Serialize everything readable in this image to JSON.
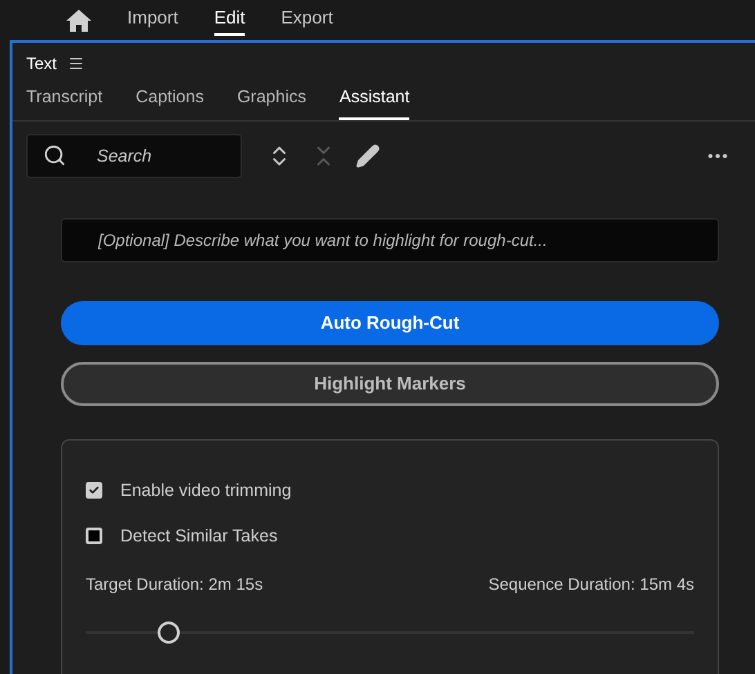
{
  "nav": [
    {
      "kind": "home",
      "selected": false
    },
    {
      "kind": "text",
      "label": "Import",
      "selected": false
    },
    {
      "kind": "text",
      "label": "Edit",
      "selected": true
    },
    {
      "kind": "text",
      "label": "Export",
      "selected": false
    }
  ],
  "panel": {
    "title": "Text"
  },
  "tabs": [
    {
      "label": "Transcript",
      "selected": false
    },
    {
      "label": "Captions",
      "selected": false
    },
    {
      "label": "Graphics",
      "selected": false
    },
    {
      "label": "Assistant",
      "selected": true
    }
  ],
  "search": {
    "placeholder": "Search"
  },
  "toolbar": [
    {
      "kind": "expand",
      "disabled": false
    },
    {
      "kind": "collapse",
      "disabled": true
    },
    {
      "kind": "edit",
      "disabled": false
    }
  ],
  "prompt": {
    "placeholder": "[Optional] Describe what you want to highlight for rough-cut..."
  },
  "buttons": [
    {
      "label": "Auto Rough-Cut",
      "kind": "primary"
    },
    {
      "label": "Highlight Markers",
      "kind": "secondary"
    }
  ],
  "options": [
    {
      "label": "Enable video trimming",
      "checked": true
    },
    {
      "label": "Detect Similar Takes",
      "checked": false
    }
  ],
  "target_duration": "Target Duration: 2m 15s",
  "sequence_duration": "Sequence Duration: 15m 4s",
  "slider": {
    "level": 0.137
  }
}
